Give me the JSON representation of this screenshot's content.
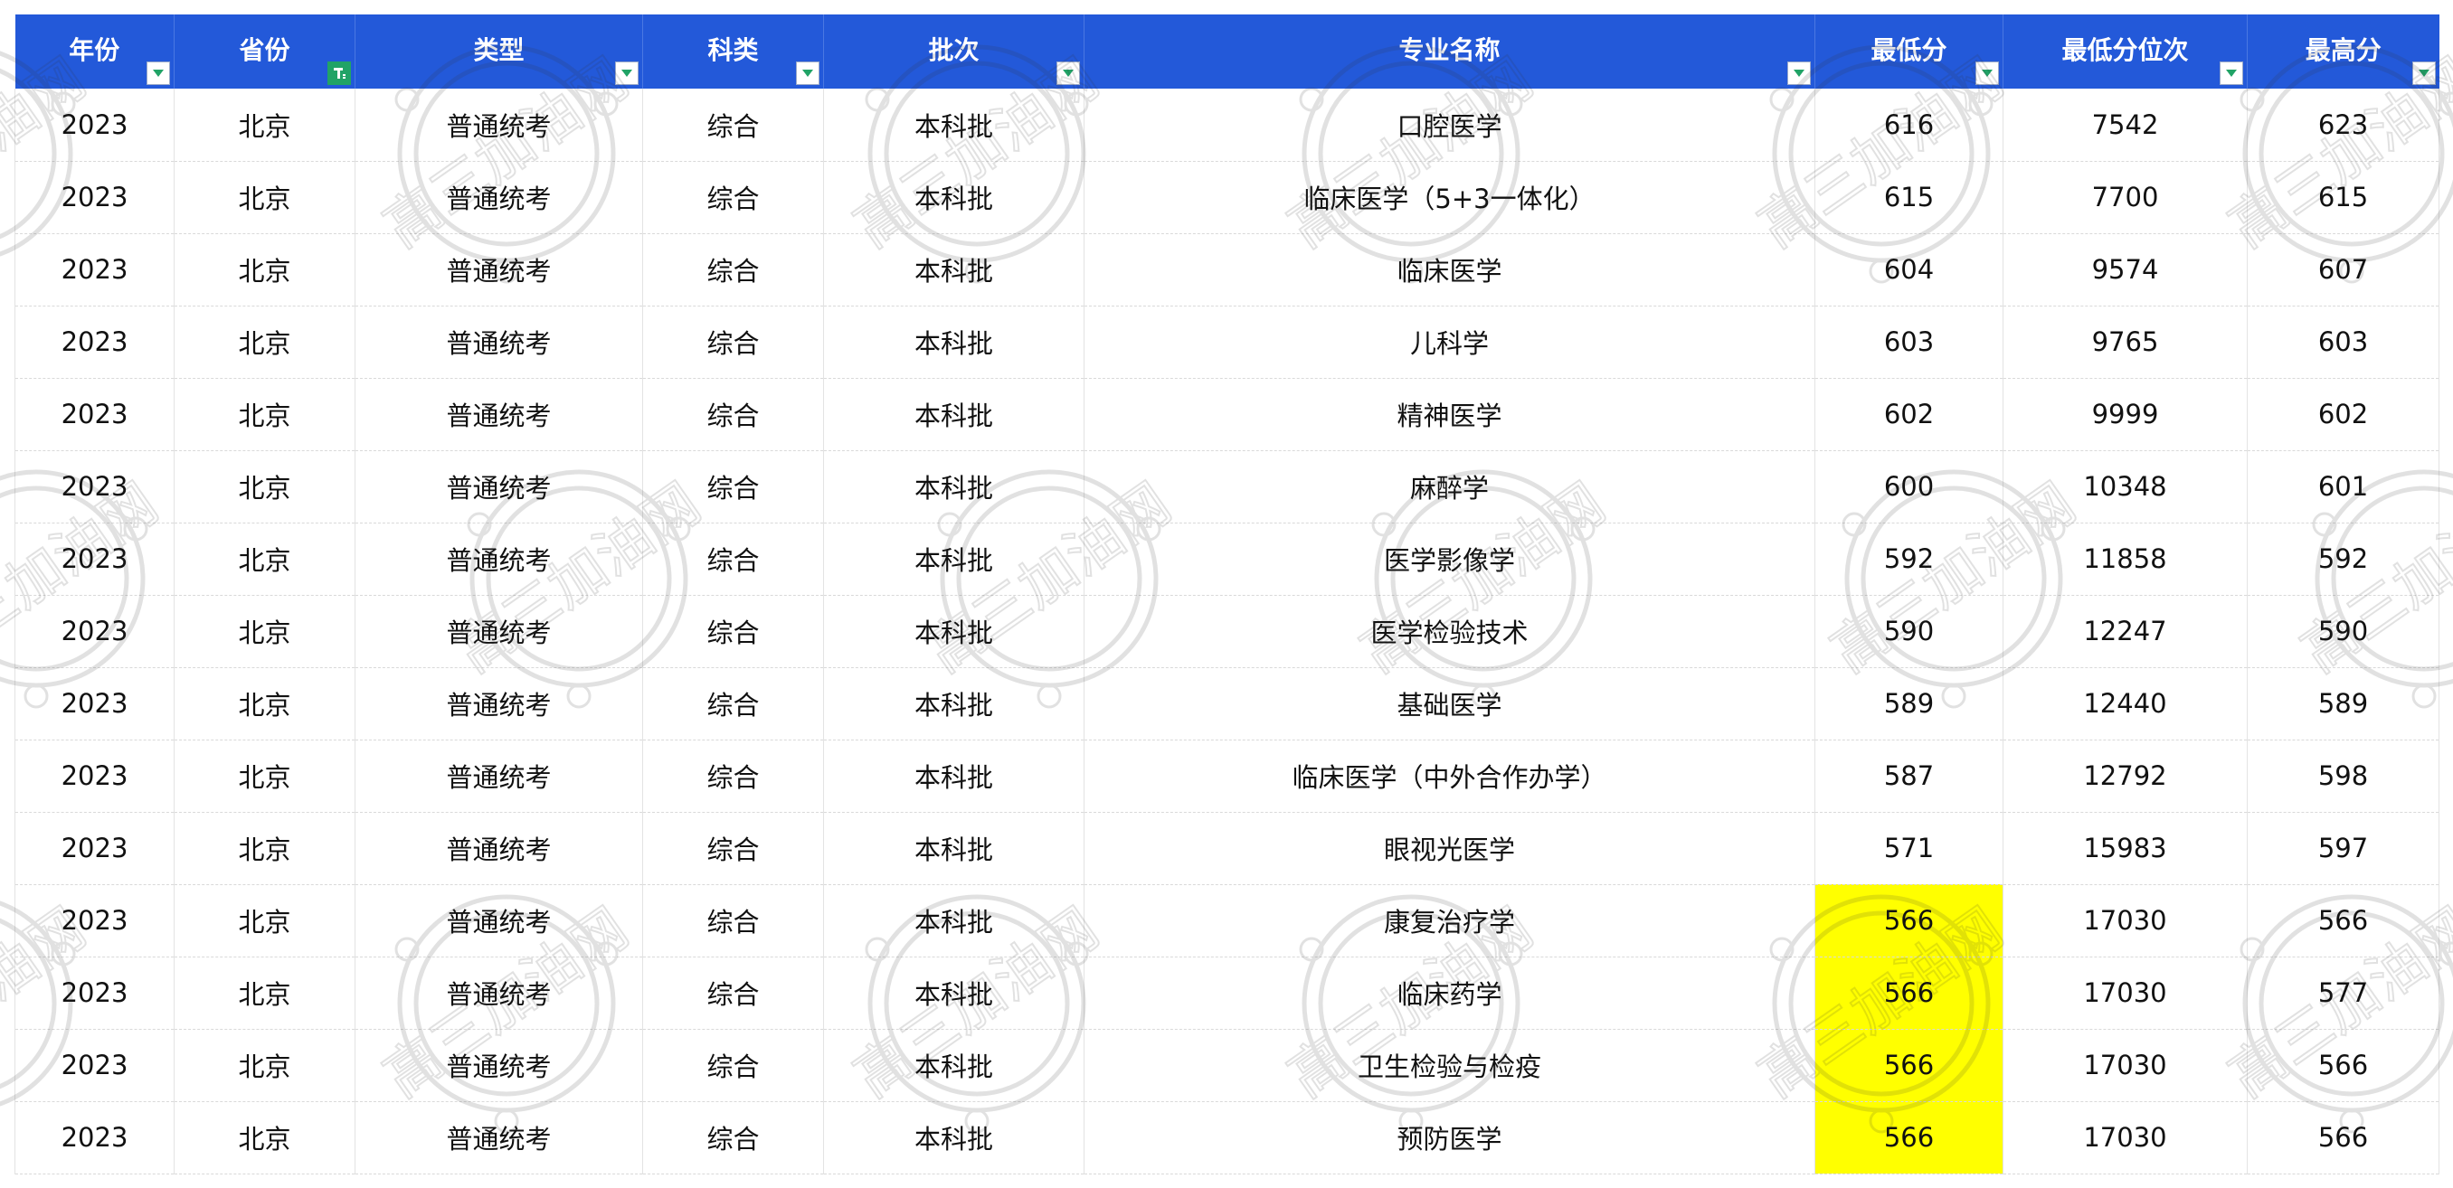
{
  "table": {
    "headers": [
      "年份",
      "省份",
      "类型",
      "科类",
      "批次",
      "专业名称",
      "最低分",
      "最低分位次",
      "最高分"
    ],
    "filter_icon": "filter-dropdown-icon",
    "active_filter_icon": "text-filter-icon",
    "highlight_color": "#ffff00",
    "header_color": "#2359d9",
    "rows": [
      [
        "2023",
        "北京",
        "普通统考",
        "综合",
        "本科批",
        "口腔医学",
        "616",
        "7542",
        "623"
      ],
      [
        "2023",
        "北京",
        "普通统考",
        "综合",
        "本科批",
        "临床医学（5+3一体化）",
        "615",
        "7700",
        "615"
      ],
      [
        "2023",
        "北京",
        "普通统考",
        "综合",
        "本科批",
        "临床医学",
        "604",
        "9574",
        "607"
      ],
      [
        "2023",
        "北京",
        "普通统考",
        "综合",
        "本科批",
        "儿科学",
        "603",
        "9765",
        "603"
      ],
      [
        "2023",
        "北京",
        "普通统考",
        "综合",
        "本科批",
        "精神医学",
        "602",
        "9999",
        "602"
      ],
      [
        "2023",
        "北京",
        "普通统考",
        "综合",
        "本科批",
        "麻醉学",
        "600",
        "10348",
        "601"
      ],
      [
        "2023",
        "北京",
        "普通统考",
        "综合",
        "本科批",
        "医学影像学",
        "592",
        "11858",
        "592"
      ],
      [
        "2023",
        "北京",
        "普通统考",
        "综合",
        "本科批",
        "医学检验技术",
        "590",
        "12247",
        "590"
      ],
      [
        "2023",
        "北京",
        "普通统考",
        "综合",
        "本科批",
        "基础医学",
        "589",
        "12440",
        "589"
      ],
      [
        "2023",
        "北京",
        "普通统考",
        "综合",
        "本科批",
        "临床医学（中外合作办学）",
        "587",
        "12792",
        "598"
      ],
      [
        "2023",
        "北京",
        "普通统考",
        "综合",
        "本科批",
        "眼视光医学",
        "571",
        "15983",
        "597"
      ],
      [
        "2023",
        "北京",
        "普通统考",
        "综合",
        "本科批",
        "康复治疗学",
        "566",
        "17030",
        "566"
      ],
      [
        "2023",
        "北京",
        "普通统考",
        "综合",
        "本科批",
        "临床药学",
        "566",
        "17030",
        "577"
      ],
      [
        "2023",
        "北京",
        "普通统考",
        "综合",
        "本科批",
        "卫生检验与检疫",
        "566",
        "17030",
        "566"
      ],
      [
        "2023",
        "北京",
        "普通统考",
        "综合",
        "本科批",
        "预防医学",
        "566",
        "17030",
        "566"
      ]
    ],
    "highlighted_rows": [
      11,
      12,
      13,
      14
    ],
    "highlighted_column": 6
  },
  "watermark": {
    "text": "高三加油网"
  }
}
